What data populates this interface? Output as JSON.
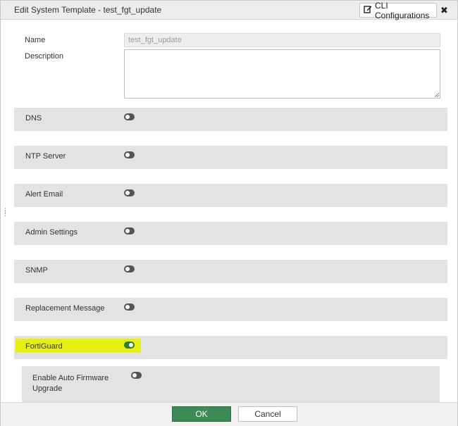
{
  "dialog": {
    "title": "Edit System Template - test_fgt_update",
    "cli_button_label": "CLI Configurations",
    "close_glyph": "✖"
  },
  "form": {
    "name_label": "Name",
    "name_value": "test_fgt_update",
    "description_label": "Description",
    "description_value": ""
  },
  "sections": [
    {
      "label": "DNS",
      "enabled": false
    },
    {
      "label": "NTP Server",
      "enabled": false
    },
    {
      "label": "Alert Email",
      "enabled": false
    },
    {
      "label": "Admin Settings",
      "enabled": false
    },
    {
      "label": "SNMP",
      "enabled": false
    },
    {
      "label": "Replacement Message",
      "enabled": false
    },
    {
      "label": "FortiGuard",
      "enabled": true,
      "highlighted": true
    }
  ],
  "fortiguard": {
    "auto_upgrade_label": "Enable Auto Firmware Upgrade",
    "auto_upgrade_enabled": false
  },
  "footer": {
    "ok_label": "OK",
    "cancel_label": "Cancel"
  },
  "colors": {
    "ok_button": "#3c8a55",
    "toggle_on": "#2e7d32",
    "toggle_off": "#555555",
    "highlight": "#e6ef0f",
    "section_bg": "#e3e3e3"
  },
  "icons": {
    "cli": "edit-square-icon",
    "close": "close-icon",
    "drag": "drag-handle-icon"
  }
}
